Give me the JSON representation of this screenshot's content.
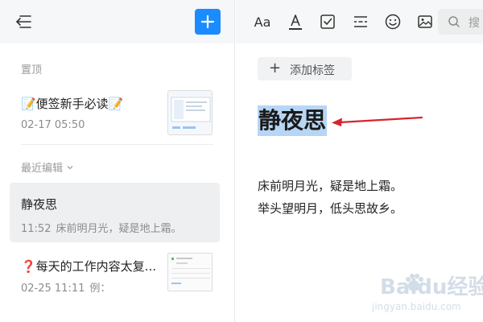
{
  "sidebar": {
    "pinned_label": "置顶",
    "recent_label": "最近编辑",
    "pinned_note": {
      "title": "📝便签新手必读📝",
      "date": "02-17 05:50"
    },
    "recent_notes": [
      {
        "title": "静夜思",
        "time": "11:52",
        "snippet": "床前明月光，疑是地上霜。",
        "active": true
      },
      {
        "title": "❓每天的工作内容太复...",
        "time": "02-25 11:11",
        "snippet": "例：",
        "active": false
      }
    ]
  },
  "toolbar": {
    "font_label": "Aa",
    "search_placeholder": "搜"
  },
  "editor": {
    "add_tag_label": "添加标签",
    "title": "静夜思",
    "lines": [
      "床前明月光，疑是地上霜。",
      "举头望明月，低头思故乡。"
    ]
  },
  "watermark": {
    "brand": "Baidu经验",
    "url": "jingyan.baidu.com"
  },
  "colors": {
    "accent": "#1a8cff",
    "selection": "#b7d6f5",
    "annotation_arrow": "#d9232e"
  }
}
